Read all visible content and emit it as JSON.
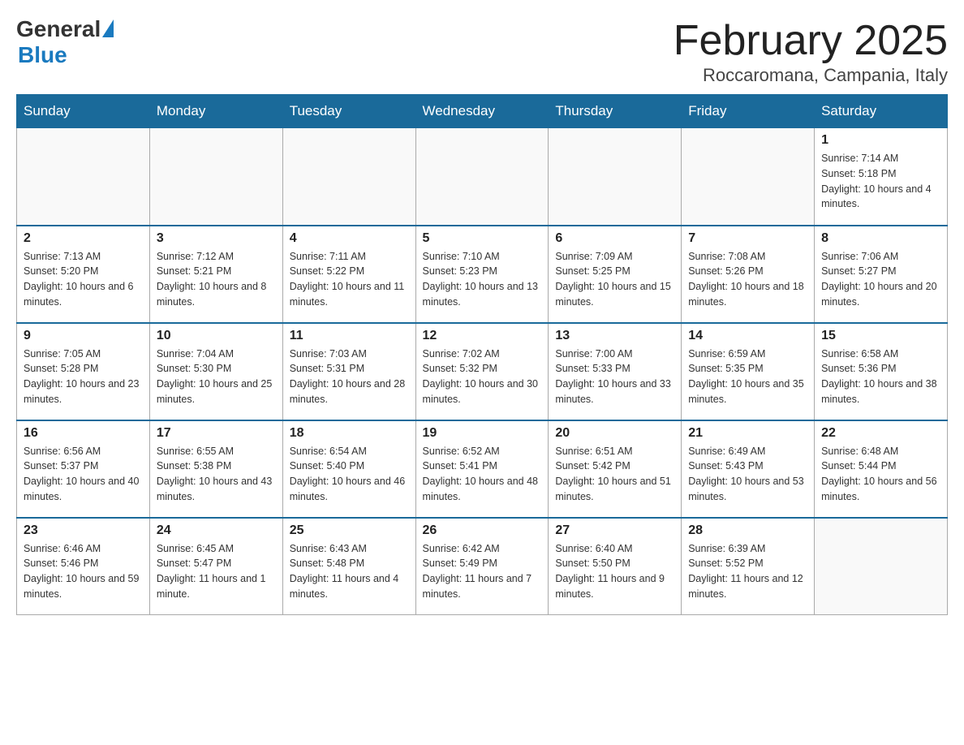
{
  "logo": {
    "general": "General",
    "blue": "Blue"
  },
  "title": "February 2025",
  "subtitle": "Roccaromana, Campania, Italy",
  "days_of_week": [
    "Sunday",
    "Monday",
    "Tuesday",
    "Wednesday",
    "Thursday",
    "Friday",
    "Saturday"
  ],
  "weeks": [
    [
      {
        "day": "",
        "info": ""
      },
      {
        "day": "",
        "info": ""
      },
      {
        "day": "",
        "info": ""
      },
      {
        "day": "",
        "info": ""
      },
      {
        "day": "",
        "info": ""
      },
      {
        "day": "",
        "info": ""
      },
      {
        "day": "1",
        "info": "Sunrise: 7:14 AM\nSunset: 5:18 PM\nDaylight: 10 hours and 4 minutes."
      }
    ],
    [
      {
        "day": "2",
        "info": "Sunrise: 7:13 AM\nSunset: 5:20 PM\nDaylight: 10 hours and 6 minutes."
      },
      {
        "day": "3",
        "info": "Sunrise: 7:12 AM\nSunset: 5:21 PM\nDaylight: 10 hours and 8 minutes."
      },
      {
        "day": "4",
        "info": "Sunrise: 7:11 AM\nSunset: 5:22 PM\nDaylight: 10 hours and 11 minutes."
      },
      {
        "day": "5",
        "info": "Sunrise: 7:10 AM\nSunset: 5:23 PM\nDaylight: 10 hours and 13 minutes."
      },
      {
        "day": "6",
        "info": "Sunrise: 7:09 AM\nSunset: 5:25 PM\nDaylight: 10 hours and 15 minutes."
      },
      {
        "day": "7",
        "info": "Sunrise: 7:08 AM\nSunset: 5:26 PM\nDaylight: 10 hours and 18 minutes."
      },
      {
        "day": "8",
        "info": "Sunrise: 7:06 AM\nSunset: 5:27 PM\nDaylight: 10 hours and 20 minutes."
      }
    ],
    [
      {
        "day": "9",
        "info": "Sunrise: 7:05 AM\nSunset: 5:28 PM\nDaylight: 10 hours and 23 minutes."
      },
      {
        "day": "10",
        "info": "Sunrise: 7:04 AM\nSunset: 5:30 PM\nDaylight: 10 hours and 25 minutes."
      },
      {
        "day": "11",
        "info": "Sunrise: 7:03 AM\nSunset: 5:31 PM\nDaylight: 10 hours and 28 minutes."
      },
      {
        "day": "12",
        "info": "Sunrise: 7:02 AM\nSunset: 5:32 PM\nDaylight: 10 hours and 30 minutes."
      },
      {
        "day": "13",
        "info": "Sunrise: 7:00 AM\nSunset: 5:33 PM\nDaylight: 10 hours and 33 minutes."
      },
      {
        "day": "14",
        "info": "Sunrise: 6:59 AM\nSunset: 5:35 PM\nDaylight: 10 hours and 35 minutes."
      },
      {
        "day": "15",
        "info": "Sunrise: 6:58 AM\nSunset: 5:36 PM\nDaylight: 10 hours and 38 minutes."
      }
    ],
    [
      {
        "day": "16",
        "info": "Sunrise: 6:56 AM\nSunset: 5:37 PM\nDaylight: 10 hours and 40 minutes."
      },
      {
        "day": "17",
        "info": "Sunrise: 6:55 AM\nSunset: 5:38 PM\nDaylight: 10 hours and 43 minutes."
      },
      {
        "day": "18",
        "info": "Sunrise: 6:54 AM\nSunset: 5:40 PM\nDaylight: 10 hours and 46 minutes."
      },
      {
        "day": "19",
        "info": "Sunrise: 6:52 AM\nSunset: 5:41 PM\nDaylight: 10 hours and 48 minutes."
      },
      {
        "day": "20",
        "info": "Sunrise: 6:51 AM\nSunset: 5:42 PM\nDaylight: 10 hours and 51 minutes."
      },
      {
        "day": "21",
        "info": "Sunrise: 6:49 AM\nSunset: 5:43 PM\nDaylight: 10 hours and 53 minutes."
      },
      {
        "day": "22",
        "info": "Sunrise: 6:48 AM\nSunset: 5:44 PM\nDaylight: 10 hours and 56 minutes."
      }
    ],
    [
      {
        "day": "23",
        "info": "Sunrise: 6:46 AM\nSunset: 5:46 PM\nDaylight: 10 hours and 59 minutes."
      },
      {
        "day": "24",
        "info": "Sunrise: 6:45 AM\nSunset: 5:47 PM\nDaylight: 11 hours and 1 minute."
      },
      {
        "day": "25",
        "info": "Sunrise: 6:43 AM\nSunset: 5:48 PM\nDaylight: 11 hours and 4 minutes."
      },
      {
        "day": "26",
        "info": "Sunrise: 6:42 AM\nSunset: 5:49 PM\nDaylight: 11 hours and 7 minutes."
      },
      {
        "day": "27",
        "info": "Sunrise: 6:40 AM\nSunset: 5:50 PM\nDaylight: 11 hours and 9 minutes."
      },
      {
        "day": "28",
        "info": "Sunrise: 6:39 AM\nSunset: 5:52 PM\nDaylight: 11 hours and 12 minutes."
      },
      {
        "day": "",
        "info": ""
      }
    ]
  ]
}
